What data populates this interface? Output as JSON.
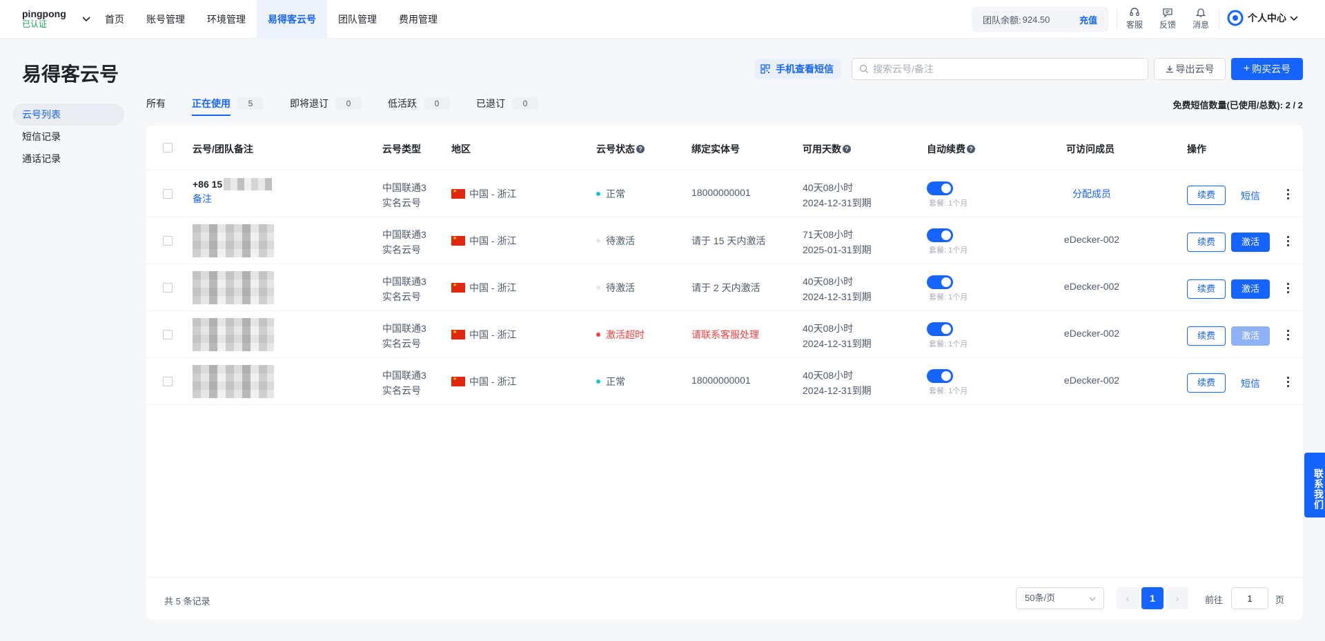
{
  "brand": {
    "org": "pingpong",
    "verified": "已认证"
  },
  "nav": [
    "首页",
    "账号管理",
    "环境管理",
    "易得客云号",
    "团队管理",
    "费用管理"
  ],
  "nav_active": "易得客云号",
  "balance": {
    "label": "团队余额:",
    "amount": "924.50",
    "recharge": "充值"
  },
  "tools": {
    "support": "客服",
    "feedback": "反馈",
    "messages": "消息"
  },
  "profile": {
    "label": "个人中心"
  },
  "page_title": "易得客云号",
  "sidebar": [
    "云号列表",
    "短信记录",
    "通话记录"
  ],
  "actions": {
    "mobile_sms": "手机查看短信",
    "search_placeholder": "搜索云号/备注",
    "export": "导出云号",
    "buy": "购买云号"
  },
  "tabs": [
    {
      "label": "所有",
      "count": null
    },
    {
      "label": "正在使用",
      "count": "5"
    },
    {
      "label": "即将退订",
      "count": "0"
    },
    {
      "label": "低活跃",
      "count": "0"
    },
    {
      "label": "已退订",
      "count": "0"
    }
  ],
  "sms_quota": "免费短信数量(已使用/总数): 2 / 2",
  "columns": [
    "云号/团队备注",
    "云号类型",
    "地区",
    "云号状态",
    "绑定实体号",
    "可用天数",
    "自动续费",
    "可访问成员",
    "操作"
  ],
  "rows": [
    {
      "number": "+86 15",
      "note": "备注",
      "type1": "中国联通3",
      "type2": "实名云号",
      "region": "中国 - 浙江",
      "status": "正常",
      "status_color": "#14c9c9",
      "bind": "18000000001",
      "bind_color": "#4e5969",
      "days": "40天08小时",
      "expire": "2024-12-31到期",
      "plan": "套餐: 1个月",
      "member": "分配成员",
      "member_link": true,
      "renew": "续费",
      "action": "短信",
      "action_kind": "link"
    },
    {
      "number": "",
      "note": "",
      "type1": "中国联通3",
      "type2": "实名云号",
      "region": "中国 - 浙江",
      "status": "待激活",
      "status_color": "#e5e6eb",
      "bind": "请于 15 天内激活",
      "bind_color": "#4e5969",
      "days": "71天08小时",
      "expire": "2025-01-31到期",
      "plan": "套餐: 1个月",
      "member": "eDecker-002",
      "member_link": false,
      "renew": "续费",
      "action": "激活",
      "action_kind": "primary"
    },
    {
      "number": "",
      "note": "",
      "type1": "中国联通3",
      "type2": "实名云号",
      "region": "中国 - 浙江",
      "status": "待激活",
      "status_color": "#e5e6eb",
      "bind": "请于 2 天内激活",
      "bind_color": "#4e5969",
      "days": "40天08小时",
      "expire": "2024-12-31到期",
      "plan": "套餐: 1个月",
      "member": "eDecker-002",
      "member_link": false,
      "renew": "续费",
      "action": "激活",
      "action_kind": "primary"
    },
    {
      "number": "",
      "note": "",
      "type1": "中国联通3",
      "type2": "实名云号",
      "region": "中国 - 浙江",
      "status": "激活超时",
      "status_color": "#f53f3f",
      "bind": "请联系客服处理",
      "bind_color": "#f53f3f",
      "days": "40天08小时",
      "expire": "2024-12-31到期",
      "plan": "套餐: 1个月",
      "member": "eDecker-002",
      "member_link": false,
      "renew": "续费",
      "action": "激活",
      "action_kind": "disabled"
    },
    {
      "number": "",
      "note": "",
      "type1": "中国联通3",
      "type2": "实名云号",
      "region": "中国 - 浙江",
      "status": "正常",
      "status_color": "#14c9c9",
      "bind": "18000000001",
      "bind_color": "#4e5969",
      "days": "40天08小时",
      "expire": "2024-12-31到期",
      "plan": "套餐: 1个月",
      "member": "eDecker-002",
      "member_link": false,
      "renew": "续费",
      "action": "短信",
      "action_kind": "link"
    }
  ],
  "pagination": {
    "total": "共 5 条记录",
    "page_size": "50条/页",
    "current": "1",
    "goto_label": "前往",
    "goto_value": "1",
    "unit": "页"
  },
  "contact": "联系我们"
}
